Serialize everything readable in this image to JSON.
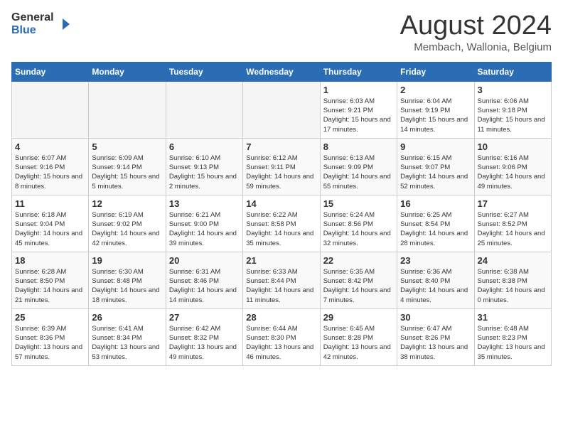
{
  "header": {
    "logo_general": "General",
    "logo_blue": "Blue",
    "month_title": "August 2024",
    "location": "Membach, Wallonia, Belgium"
  },
  "weekdays": [
    "Sunday",
    "Monday",
    "Tuesday",
    "Wednesday",
    "Thursday",
    "Friday",
    "Saturday"
  ],
  "weeks": [
    [
      {
        "day": "",
        "empty": true
      },
      {
        "day": "",
        "empty": true
      },
      {
        "day": "",
        "empty": true
      },
      {
        "day": "",
        "empty": true
      },
      {
        "day": "1",
        "sunrise": "6:03 AM",
        "sunset": "9:21 PM",
        "daylight": "15 hours and 17 minutes."
      },
      {
        "day": "2",
        "sunrise": "6:04 AM",
        "sunset": "9:19 PM",
        "daylight": "15 hours and 14 minutes."
      },
      {
        "day": "3",
        "sunrise": "6:06 AM",
        "sunset": "9:18 PM",
        "daylight": "15 hours and 11 minutes."
      }
    ],
    [
      {
        "day": "4",
        "sunrise": "6:07 AM",
        "sunset": "9:16 PM",
        "daylight": "15 hours and 8 minutes."
      },
      {
        "day": "5",
        "sunrise": "6:09 AM",
        "sunset": "9:14 PM",
        "daylight": "15 hours and 5 minutes."
      },
      {
        "day": "6",
        "sunrise": "6:10 AM",
        "sunset": "9:13 PM",
        "daylight": "15 hours and 2 minutes."
      },
      {
        "day": "7",
        "sunrise": "6:12 AM",
        "sunset": "9:11 PM",
        "daylight": "14 hours and 59 minutes."
      },
      {
        "day": "8",
        "sunrise": "6:13 AM",
        "sunset": "9:09 PM",
        "daylight": "14 hours and 55 minutes."
      },
      {
        "day": "9",
        "sunrise": "6:15 AM",
        "sunset": "9:07 PM",
        "daylight": "14 hours and 52 minutes."
      },
      {
        "day": "10",
        "sunrise": "6:16 AM",
        "sunset": "9:06 PM",
        "daylight": "14 hours and 49 minutes."
      }
    ],
    [
      {
        "day": "11",
        "sunrise": "6:18 AM",
        "sunset": "9:04 PM",
        "daylight": "14 hours and 45 minutes."
      },
      {
        "day": "12",
        "sunrise": "6:19 AM",
        "sunset": "9:02 PM",
        "daylight": "14 hours and 42 minutes."
      },
      {
        "day": "13",
        "sunrise": "6:21 AM",
        "sunset": "9:00 PM",
        "daylight": "14 hours and 39 minutes."
      },
      {
        "day": "14",
        "sunrise": "6:22 AM",
        "sunset": "8:58 PM",
        "daylight": "14 hours and 35 minutes."
      },
      {
        "day": "15",
        "sunrise": "6:24 AM",
        "sunset": "8:56 PM",
        "daylight": "14 hours and 32 minutes."
      },
      {
        "day": "16",
        "sunrise": "6:25 AM",
        "sunset": "8:54 PM",
        "daylight": "14 hours and 28 minutes."
      },
      {
        "day": "17",
        "sunrise": "6:27 AM",
        "sunset": "8:52 PM",
        "daylight": "14 hours and 25 minutes."
      }
    ],
    [
      {
        "day": "18",
        "sunrise": "6:28 AM",
        "sunset": "8:50 PM",
        "daylight": "14 hours and 21 minutes."
      },
      {
        "day": "19",
        "sunrise": "6:30 AM",
        "sunset": "8:48 PM",
        "daylight": "14 hours and 18 minutes."
      },
      {
        "day": "20",
        "sunrise": "6:31 AM",
        "sunset": "8:46 PM",
        "daylight": "14 hours and 14 minutes."
      },
      {
        "day": "21",
        "sunrise": "6:33 AM",
        "sunset": "8:44 PM",
        "daylight": "14 hours and 11 minutes."
      },
      {
        "day": "22",
        "sunrise": "6:35 AM",
        "sunset": "8:42 PM",
        "daylight": "14 hours and 7 minutes."
      },
      {
        "day": "23",
        "sunrise": "6:36 AM",
        "sunset": "8:40 PM",
        "daylight": "14 hours and 4 minutes."
      },
      {
        "day": "24",
        "sunrise": "6:38 AM",
        "sunset": "8:38 PM",
        "daylight": "14 hours and 0 minutes."
      }
    ],
    [
      {
        "day": "25",
        "sunrise": "6:39 AM",
        "sunset": "8:36 PM",
        "daylight": "13 hours and 57 minutes."
      },
      {
        "day": "26",
        "sunrise": "6:41 AM",
        "sunset": "8:34 PM",
        "daylight": "13 hours and 53 minutes."
      },
      {
        "day": "27",
        "sunrise": "6:42 AM",
        "sunset": "8:32 PM",
        "daylight": "13 hours and 49 minutes."
      },
      {
        "day": "28",
        "sunrise": "6:44 AM",
        "sunset": "8:30 PM",
        "daylight": "13 hours and 46 minutes."
      },
      {
        "day": "29",
        "sunrise": "6:45 AM",
        "sunset": "8:28 PM",
        "daylight": "13 hours and 42 minutes."
      },
      {
        "day": "30",
        "sunrise": "6:47 AM",
        "sunset": "8:26 PM",
        "daylight": "13 hours and 38 minutes."
      },
      {
        "day": "31",
        "sunrise": "6:48 AM",
        "sunset": "8:23 PM",
        "daylight": "13 hours and 35 minutes."
      }
    ]
  ]
}
